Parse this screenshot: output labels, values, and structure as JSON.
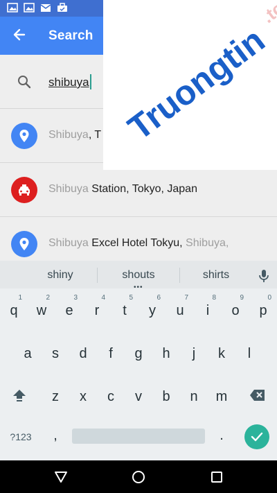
{
  "status_bar": {
    "icons": [
      "image-icon",
      "image-icon",
      "mail-icon",
      "briefcase-icon"
    ]
  },
  "app_bar": {
    "back_icon": "arrow-back-icon",
    "title": "Search"
  },
  "search": {
    "value": "shibuya",
    "icon": "search-icon"
  },
  "results": [
    {
      "icon": "place-pin-icon",
      "color": "#4285f4",
      "muted": "Shibuya",
      "rest": ", T",
      "tail": ""
    },
    {
      "icon": "taxi-icon",
      "color": "#dd1f1f",
      "muted": "Shibuya",
      "rest": " Station, Tokyo, Japan",
      "tail": ""
    },
    {
      "icon": "place-pin-icon",
      "color": "#4285f4",
      "muted": "Shibuya",
      "rest": " Excel Hotel Tokyu, ",
      "tail": "Shibuya,"
    }
  ],
  "watermark": {
    "text": "Truongtin",
    "suffix": ".top",
    "color": "#1a5fc8"
  },
  "keyboard": {
    "suggestions": [
      "shiny",
      "shouts",
      "shirts"
    ],
    "dots": "•••",
    "row1": [
      {
        "ch": "q",
        "hint": "1"
      },
      {
        "ch": "w",
        "hint": "2"
      },
      {
        "ch": "e",
        "hint": "3"
      },
      {
        "ch": "r",
        "hint": "4"
      },
      {
        "ch": "t",
        "hint": "5"
      },
      {
        "ch": "y",
        "hint": "6"
      },
      {
        "ch": "u",
        "hint": "7"
      },
      {
        "ch": "i",
        "hint": "8"
      },
      {
        "ch": "o",
        "hint": "9"
      },
      {
        "ch": "p",
        "hint": "0"
      }
    ],
    "row2": [
      "a",
      "s",
      "d",
      "f",
      "g",
      "h",
      "j",
      "k",
      "l"
    ],
    "row3": [
      "z",
      "x",
      "c",
      "v",
      "b",
      "n",
      "m"
    ],
    "symbols_label": "?123",
    "comma": ",",
    "period": ".",
    "accent": "#2bb39b"
  },
  "nav_bar": {
    "back": "back-triangle-icon",
    "home": "home-circle-icon",
    "recents": "recents-square-icon"
  }
}
